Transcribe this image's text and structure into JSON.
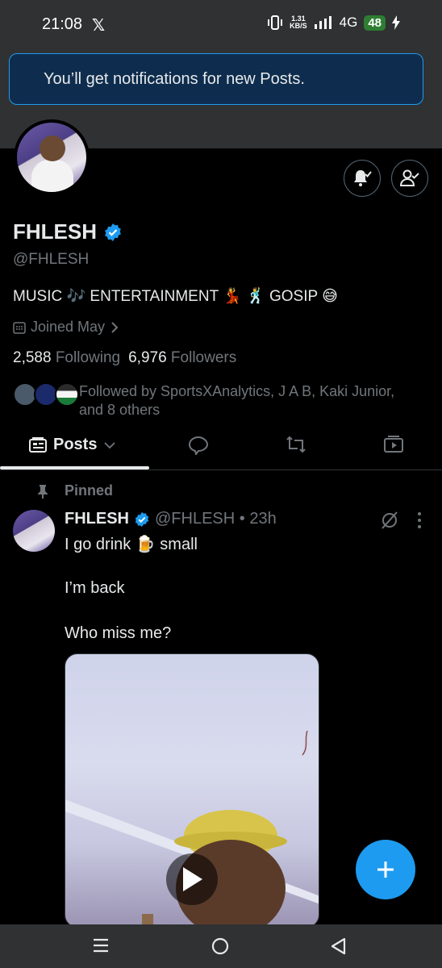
{
  "status_bar": {
    "time": "21:08",
    "x_logo": "𝕏",
    "net_speed_value": "1.31",
    "net_speed_unit": "KB/S",
    "network": "4G",
    "battery": "48"
  },
  "toast": {
    "text": "You’ll get notifications for new Posts."
  },
  "profile": {
    "name": "FHLESH",
    "handle": "@FHLESH",
    "bio": "MUSIC 🎶 ENTERTAINMENT 💃 🕺 GOSIP 😅",
    "joined": "Joined May",
    "following_count": "2,588",
    "following_label": "Following",
    "followers_count": "6,976",
    "followers_label": "Followers",
    "followed_by": "Followed by SportsXAnalytics, J A B, Kaki Junior, and 8 others"
  },
  "tabs": {
    "posts_label": "Posts"
  },
  "post": {
    "pinned_label": "Pinned",
    "author": "FHLESH",
    "handle_time": "@FHLESH • 23h",
    "line1": "I go drink 🍺 small",
    "line2": "I’m back",
    "line3": "Who miss me?"
  },
  "icons": {
    "notify": "bell-check-icon",
    "following": "person-check-icon",
    "fab": "plus-icon"
  },
  "colors": {
    "accent": "#1d9bf0",
    "background": "#000000",
    "muted": "#71767b"
  }
}
